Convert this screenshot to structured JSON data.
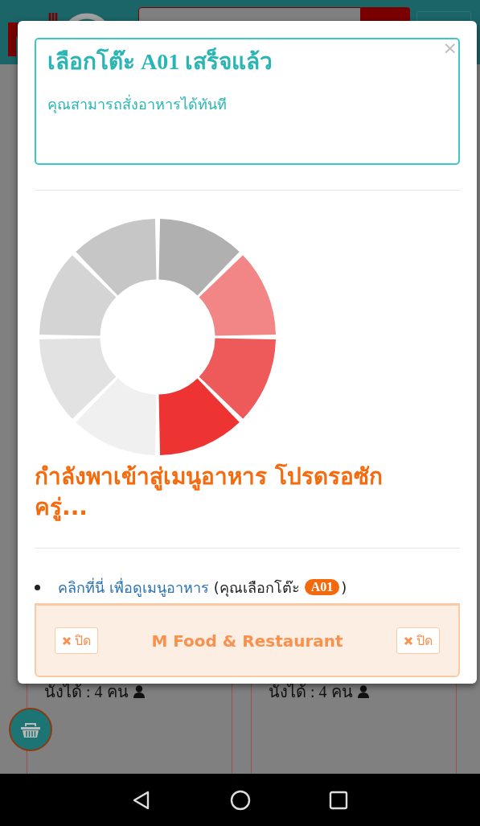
{
  "cards": [
    {
      "seats": "นั่งได้ : 4 คน"
    },
    {
      "seats": "นั่งได้ : 4 คน"
    }
  ],
  "modal": {
    "alert": {
      "title": "เลือกโต๊ะ A01 เสร็จแล้ว",
      "message": "คุณสามารถสั่งอาหารได้ทันที",
      "close": "×"
    },
    "loading_text": "กำลังพาเข้าสู่เมนูอาหาร โปรดรอซักครู่...",
    "menu_item": {
      "link": "คลิกที่นี่ เพื่อดูเมนูอาหาร",
      "note": "(คุณเลือกโต๊ะ",
      "badge": "A01",
      "note_end": ")"
    },
    "footer": {
      "title": "M Food & Restaurant",
      "buttons": [
        {
          "label": "ปิด"
        },
        {
          "label": "ปิด"
        }
      ]
    }
  }
}
